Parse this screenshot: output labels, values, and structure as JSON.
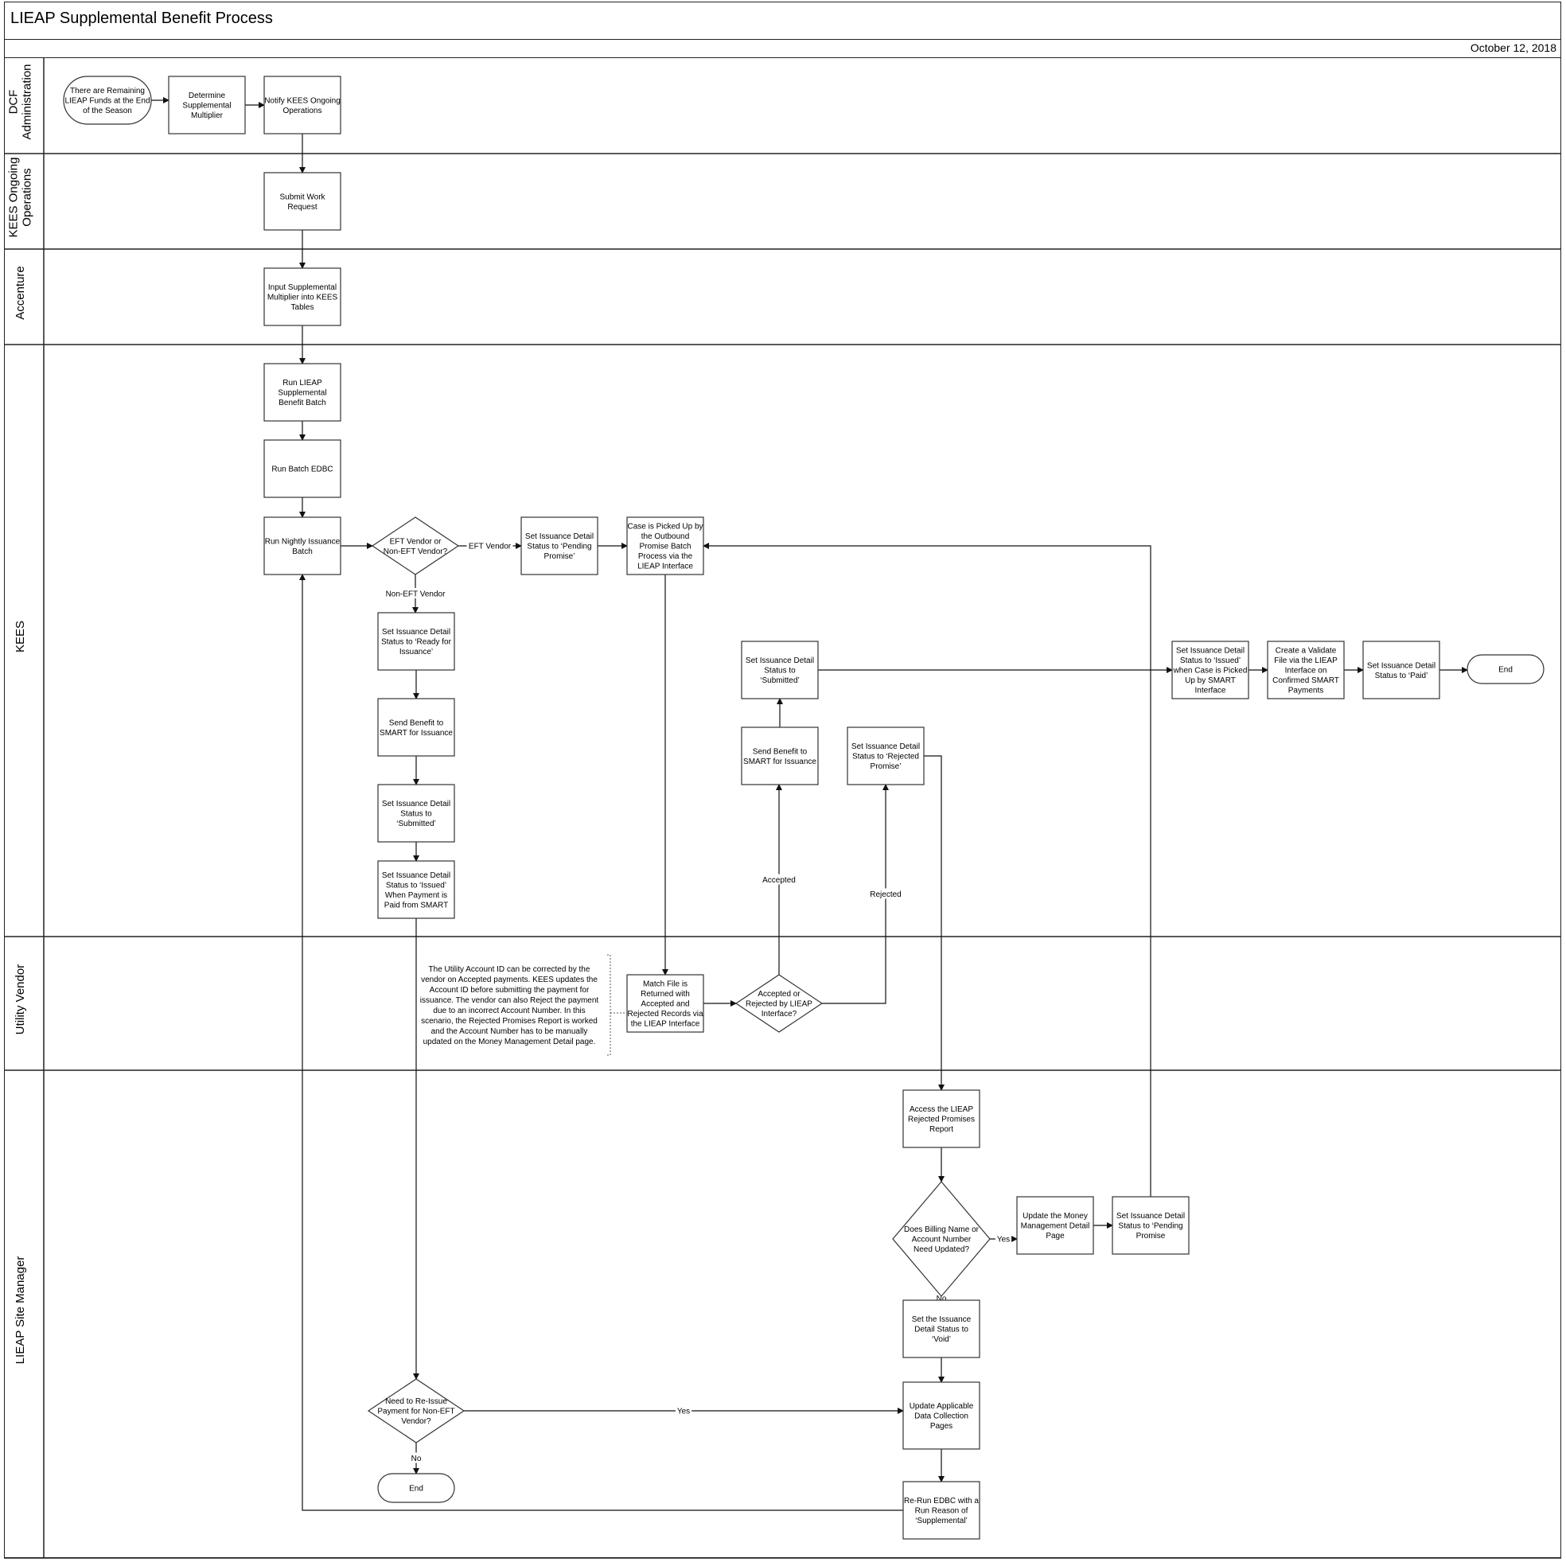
{
  "header": {
    "title": "LIEAP Supplemental Benefit Process",
    "date": "October 12, 2018"
  },
  "lanes": [
    {
      "id": "dcf",
      "label_lines": [
        "DCF",
        "Administration"
      ]
    },
    {
      "id": "kees_ops",
      "label_lines": [
        "KEES Ongoing",
        "Operations"
      ]
    },
    {
      "id": "accenture",
      "label_lines": [
        "Accenture"
      ]
    },
    {
      "id": "kees",
      "label_lines": [
        "KEES"
      ]
    },
    {
      "id": "vendor",
      "label_lines": [
        "Utility Vendor"
      ]
    },
    {
      "id": "site_mgr",
      "label_lines": [
        "LIEAP Site Manager"
      ]
    }
  ],
  "nodes": [
    {
      "id": "start",
      "type": "terminator",
      "lane": "dcf",
      "lines": [
        "There are Remaining",
        "LIEAP Funds at the End",
        "of the Season"
      ]
    },
    {
      "id": "determine",
      "type": "process",
      "lane": "dcf",
      "lines": [
        "Determine",
        "Supplemental",
        "Multiplier"
      ]
    },
    {
      "id": "notify",
      "type": "process",
      "lane": "dcf",
      "lines": [
        "Notify KEES Ongoing",
        "Operations"
      ]
    },
    {
      "id": "submit_wr",
      "type": "process",
      "lane": "kees_ops",
      "lines": [
        "Submit Work",
        "Request"
      ]
    },
    {
      "id": "input_mult",
      "type": "process",
      "lane": "accenture",
      "lines": [
        "Input Supplemental",
        "Multiplier into KEES",
        "Tables"
      ]
    },
    {
      "id": "run_lieap",
      "type": "process",
      "lane": "kees",
      "lines": [
        "Run LIEAP",
        "Supplemental",
        "Benefit Batch"
      ]
    },
    {
      "id": "run_edbc",
      "type": "process",
      "lane": "kees",
      "lines": [
        "Run Batch EDBC"
      ]
    },
    {
      "id": "run_nightly",
      "type": "process",
      "lane": "kees",
      "lines": [
        "Run Nightly Issuance",
        "Batch"
      ]
    },
    {
      "id": "eft_decision",
      "type": "decision",
      "lane": "kees",
      "lines": [
        "EFT Vendor or",
        "Non-EFT Vendor?"
      ]
    },
    {
      "id": "pending_promise",
      "type": "process",
      "lane": "kees",
      "lines": [
        "Set Issuance Detail",
        "Status to ‘Pending",
        "Promise’"
      ]
    },
    {
      "id": "case_picked",
      "type": "process",
      "lane": "kees",
      "lines": [
        "Case  is Picked Up by",
        "the Outbound",
        "Promise Batch",
        "Process via the",
        "LIEAP Interface"
      ]
    },
    {
      "id": "ready_issuance",
      "type": "process",
      "lane": "kees",
      "lines": [
        "Set Issuance Detail",
        "Status to ‘Ready for",
        "Issuance’"
      ]
    },
    {
      "id": "send_smart_1",
      "type": "process",
      "lane": "kees",
      "lines": [
        "Send Benefit to",
        "SMART for Issuance"
      ]
    },
    {
      "id": "submitted_1",
      "type": "process",
      "lane": "kees",
      "lines": [
        "Set Issuance Detail",
        "Status to",
        "‘Submitted’"
      ]
    },
    {
      "id": "issued_paid",
      "type": "process",
      "lane": "kees",
      "lines": [
        "Set Issuance Detail",
        "Status to ‘Issued’",
        "When Payment is",
        "Paid from SMART"
      ]
    },
    {
      "id": "submitted_2",
      "type": "process",
      "lane": "kees",
      "lines": [
        "Set Issuance Detail",
        "Status to",
        "‘Submitted’"
      ]
    },
    {
      "id": "send_smart_2",
      "type": "process",
      "lane": "kees",
      "lines": [
        "Send Benefit to",
        "SMART for Issuance"
      ]
    },
    {
      "id": "rejected_promise",
      "type": "process",
      "lane": "kees",
      "lines": [
        "Set Issuance Detail",
        "Status to ‘Rejected",
        "Promise’"
      ]
    },
    {
      "id": "issued_picked",
      "type": "process",
      "lane": "kees",
      "lines": [
        "Set Issuance Detail",
        "Status to ‘Issued’",
        "when Case is Picked",
        "Up by SMART",
        "Interface"
      ]
    },
    {
      "id": "validate_file",
      "type": "process",
      "lane": "kees",
      "lines": [
        "Create a Validate",
        "File via the LIEAP",
        "Interface on",
        "Confirmed SMART",
        "Payments"
      ]
    },
    {
      "id": "paid",
      "type": "process",
      "lane": "kees",
      "lines": [
        "Set Issuance Detail",
        "Status to ‘Paid’"
      ]
    },
    {
      "id": "end_1",
      "type": "terminator",
      "lane": "kees",
      "lines": [
        "End"
      ]
    },
    {
      "id": "match_file",
      "type": "process",
      "lane": "vendor",
      "lines": [
        "Match File is",
        "Returned with",
        "Accepted and",
        "Rejected Records via",
        "the LIEAP Interface"
      ]
    },
    {
      "id": "accept_decision",
      "type": "decision",
      "lane": "vendor",
      "lines": [
        "Accepted or",
        "Rejected by LIEAP",
        "Interface?"
      ]
    },
    {
      "id": "annotation",
      "type": "annotation",
      "lane": "vendor",
      "lines": [
        "The Utility Account ID can be corrected by the",
        "vendor on Accepted payments. KEES updates the",
        "Account ID before submitting the payment for",
        "issuance. The vendor can also Reject the payment",
        "due to an incorrect Account Number.  In this",
        "scenario, the Rejected Promises Report is worked",
        "and the  Account Number has to be manually",
        "updated on the Money Management Detail page."
      ]
    },
    {
      "id": "access_report",
      "type": "process",
      "lane": "site_mgr",
      "lines": [
        "Access the LIEAP",
        "Rejected Promises",
        "Report"
      ]
    },
    {
      "id": "billing_decision",
      "type": "decision",
      "lane": "site_mgr",
      "lines": [
        "Does Billing Name or",
        "Account Number",
        "Need Updated?"
      ]
    },
    {
      "id": "update_money",
      "type": "process",
      "lane": "site_mgr",
      "lines": [
        "Update the Money",
        "Management Detail",
        "Page"
      ]
    },
    {
      "id": "pending_promise_2",
      "type": "process",
      "lane": "site_mgr",
      "lines": [
        "Set Issuance Detail",
        "Status to ‘Pending",
        "Promise"
      ]
    },
    {
      "id": "void",
      "type": "process",
      "lane": "site_mgr",
      "lines": [
        "Set the Issuance",
        "Detail Status to",
        "‘Void’"
      ]
    },
    {
      "id": "reissue_decision",
      "type": "decision",
      "lane": "site_mgr",
      "lines": [
        "Need to Re-Issue",
        "Payment for Non-EFT",
        "Vendor?"
      ]
    },
    {
      "id": "update_dc",
      "type": "process",
      "lane": "site_mgr",
      "lines": [
        "Update Applicable",
        "Data Collection",
        "Pages"
      ]
    },
    {
      "id": "end_2",
      "type": "terminator",
      "lane": "site_mgr",
      "lines": [
        "End"
      ]
    },
    {
      "id": "rerun_edbc",
      "type": "process",
      "lane": "site_mgr",
      "lines": [
        "Re-Run EDBC with a",
        "Run Reason of",
        "‘Supplemental’"
      ]
    }
  ],
  "edges": [
    {
      "from": "start",
      "to": "determine",
      "label": ""
    },
    {
      "from": "determine",
      "to": "notify",
      "label": ""
    },
    {
      "from": "notify",
      "to": "submit_wr",
      "label": ""
    },
    {
      "from": "submit_wr",
      "to": "input_mult",
      "label": ""
    },
    {
      "from": "input_mult",
      "to": "run_lieap",
      "label": ""
    },
    {
      "from": "run_lieap",
      "to": "run_edbc",
      "label": ""
    },
    {
      "from": "run_edbc",
      "to": "run_nightly",
      "label": ""
    },
    {
      "from": "run_nightly",
      "to": "eft_decision",
      "label": ""
    },
    {
      "from": "eft_decision",
      "to": "pending_promise",
      "label": "EFT Vendor"
    },
    {
      "from": "eft_decision",
      "to": "ready_issuance",
      "label": "Non-EFT Vendor"
    },
    {
      "from": "pending_promise",
      "to": "case_picked",
      "label": ""
    },
    {
      "from": "case_picked",
      "to": "match_file",
      "label": ""
    },
    {
      "from": "ready_issuance",
      "to": "send_smart_1",
      "label": ""
    },
    {
      "from": "send_smart_1",
      "to": "submitted_1",
      "label": ""
    },
    {
      "from": "submitted_1",
      "to": "issued_paid",
      "label": ""
    },
    {
      "from": "issued_paid",
      "to": "reissue_decision",
      "label": ""
    },
    {
      "from": "match_file",
      "to": "accept_decision",
      "label": ""
    },
    {
      "from": "accept_decision",
      "to": "send_smart_2",
      "label": "Accepted"
    },
    {
      "from": "accept_decision",
      "to": "rejected_promise",
      "label": "Rejected"
    },
    {
      "from": "send_smart_2",
      "to": "submitted_2",
      "label": ""
    },
    {
      "from": "submitted_2",
      "to": "issued_picked",
      "label": ""
    },
    {
      "from": "issued_picked",
      "to": "validate_file",
      "label": ""
    },
    {
      "from": "validate_file",
      "to": "paid",
      "label": ""
    },
    {
      "from": "paid",
      "to": "end_1",
      "label": ""
    },
    {
      "from": "rejected_promise",
      "to": "access_report",
      "label": ""
    },
    {
      "from": "access_report",
      "to": "billing_decision",
      "label": ""
    },
    {
      "from": "billing_decision",
      "to": "update_money",
      "label": "Yes"
    },
    {
      "from": "billing_decision",
      "to": "void",
      "label": "No"
    },
    {
      "from": "update_money",
      "to": "pending_promise_2",
      "label": ""
    },
    {
      "from": "pending_promise_2",
      "to": "case_picked",
      "label": ""
    },
    {
      "from": "void",
      "to": "update_dc",
      "label": ""
    },
    {
      "from": "reissue_decision",
      "to": "update_dc",
      "label": "Yes"
    },
    {
      "from": "reissue_decision",
      "to": "end_2",
      "label": "No"
    },
    {
      "from": "update_dc",
      "to": "rerun_edbc",
      "label": ""
    },
    {
      "from": "rerun_edbc",
      "to": "run_nightly",
      "label": ""
    }
  ]
}
